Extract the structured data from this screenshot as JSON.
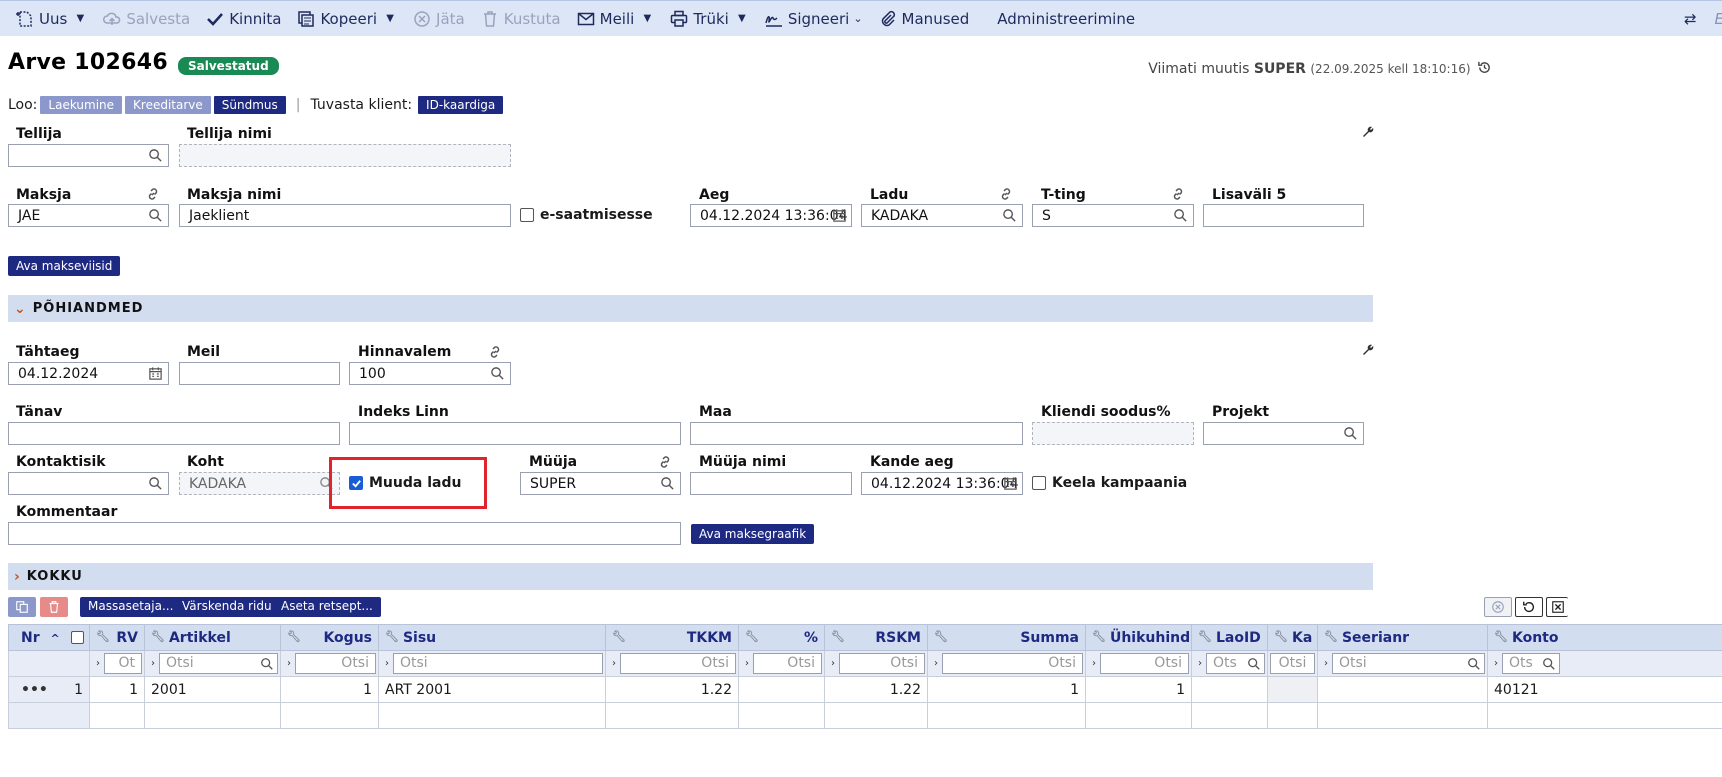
{
  "toolbar": {
    "new": "Uus",
    "save": "Salvesta",
    "confirm": "Kinnita",
    "copy": "Kopeeri",
    "skip": "Jäta",
    "delete": "Kustuta",
    "mail": "Meili",
    "print": "Trüki",
    "sign": "Signeeri",
    "attachments": "Manused",
    "admin": "Administreerimine"
  },
  "header": {
    "title": "Arve 102646",
    "status": "Salvestatud",
    "modified_prefix": "Viimati muutis",
    "modified_user": "SUPER",
    "modified_time": "(22.09.2025 kell 18:10:16)"
  },
  "create_row": {
    "label": "Loo:",
    "buttons": [
      "Laekumine",
      "Kreeditarve",
      "Sündmus"
    ],
    "identify_label": "Tuvasta klient:",
    "identify_button": "ID-kaardiga"
  },
  "fields": {
    "tellija": {
      "label": "Tellija",
      "value": ""
    },
    "tellija_nimi": {
      "label": "Tellija nimi",
      "value": ""
    },
    "maksja": {
      "label": "Maksja",
      "value": "JAE"
    },
    "maksja_nimi": {
      "label": "Maksja nimi",
      "value": "Jaeklient"
    },
    "e_saatmisesse": {
      "label": "e-saatmisesse",
      "checked": false
    },
    "aeg": {
      "label": "Aeg",
      "value": "04.12.2024 13:36:04"
    },
    "ladu": {
      "label": "Ladu",
      "value": "KADAKA"
    },
    "t_ting": {
      "label": "T-ting",
      "value": "S"
    },
    "lisavali5": {
      "label": "Lisaväli 5",
      "value": ""
    },
    "tahtaeg": {
      "label": "Tähtaeg",
      "value": "04.12.2024"
    },
    "meil": {
      "label": "Meil",
      "value": ""
    },
    "hinnavalem": {
      "label": "Hinnavalem",
      "value": "100"
    },
    "tanav": {
      "label": "Tänav",
      "value": ""
    },
    "indeks_linn": {
      "label": "Indeks Linn",
      "value": ""
    },
    "maa": {
      "label": "Maa",
      "value": ""
    },
    "kliendi_soodus": {
      "label": "Kliendi soodus%",
      "value": ""
    },
    "projekt": {
      "label": "Projekt",
      "value": ""
    },
    "kontaktisik": {
      "label": "Kontaktisik",
      "value": ""
    },
    "koht": {
      "label": "Koht",
      "value": "KADAKA"
    },
    "muuda_ladu": {
      "label": "Muuda ladu",
      "checked": true
    },
    "muuja": {
      "label": "Müüja",
      "value": "SUPER"
    },
    "muuja_nimi": {
      "label": "Müüja nimi",
      "value": ""
    },
    "kande_aeg": {
      "label": "Kande aeg",
      "value": "04.12.2024 13:36:04"
    },
    "keela_kampaania": {
      "label": "Keela kampaania",
      "checked": false
    },
    "kommentaar": {
      "label": "Kommentaar",
      "value": ""
    }
  },
  "buttons": {
    "payment_methods": "Ava makseviisid",
    "payment_schedule": "Ava maksegraafik"
  },
  "sections": {
    "main": "PÕHIANDMED",
    "total": "KOKKU"
  },
  "grid_toolbar": {
    "mass_set": "Massasetaja...",
    "refresh_rows": "Värskenda ridu",
    "set_recipe": "Aseta retsept..."
  },
  "table": {
    "columns": [
      "Nr",
      "RV",
      "Artikkel",
      "Kogus",
      "Sisu",
      "TKKM",
      "%",
      "RSKM",
      "Summa",
      "Ühikuhind",
      "LaoID",
      "Ka",
      "Seerianr",
      "Konto"
    ],
    "filter_placeholder": "Otsi",
    "filter_placeholder_short": "Ot",
    "filter_placeholder_mid": "Ots",
    "rows": [
      {
        "nr": "1",
        "rv": "1",
        "artikkel": "2001",
        "kogus": "1",
        "sisu": "ART 2001",
        "tkkm": "1.22",
        "pct": "",
        "rskm": "1.22",
        "summa": "1",
        "uhikuhind": "1",
        "laoid": "",
        "ka": "",
        "seerianr": "",
        "konto": "40121"
      }
    ]
  }
}
